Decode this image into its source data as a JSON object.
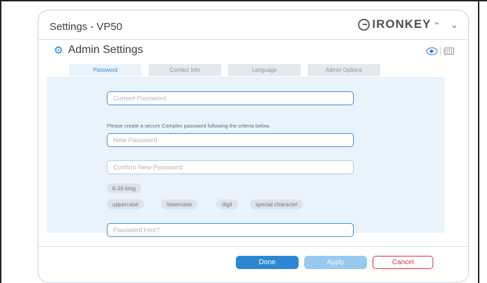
{
  "window": {
    "title": "Settings - VP50",
    "brand": "IRONKEY",
    "brand_mark": "™"
  },
  "panel": {
    "title": "Admin Settings"
  },
  "tabs": [
    {
      "label": "Password",
      "active": true
    },
    {
      "label": "Contact Info",
      "active": false
    },
    {
      "label": "Language",
      "active": false
    },
    {
      "label": "Admin Options",
      "active": false
    }
  ],
  "form": {
    "current_password_placeholder": "Current Password",
    "instruction": "Please create a secure Complex password following the criteria below.",
    "new_password_placeholder": "New Password",
    "confirm_password_placeholder": "Confirm New Password",
    "criteria_length": "6-16 long",
    "criteria": [
      "uppercase",
      "lowercase",
      "digit",
      "special character"
    ],
    "hint_placeholder": "Password Hint?"
  },
  "buttons": {
    "done": "Done",
    "apply": "Apply",
    "cancel": "Cancel"
  },
  "icons": {
    "settings": "gear-icon",
    "show_password": "eye-icon",
    "virtual_keyboard": "keyboard-icon",
    "menu": "chevron-down-icon"
  },
  "colors": {
    "accent": "#2d86d2",
    "apply_disabled": "#98c9ee",
    "cancel": "#d0354a",
    "content_bg": "#e9f3fc"
  }
}
